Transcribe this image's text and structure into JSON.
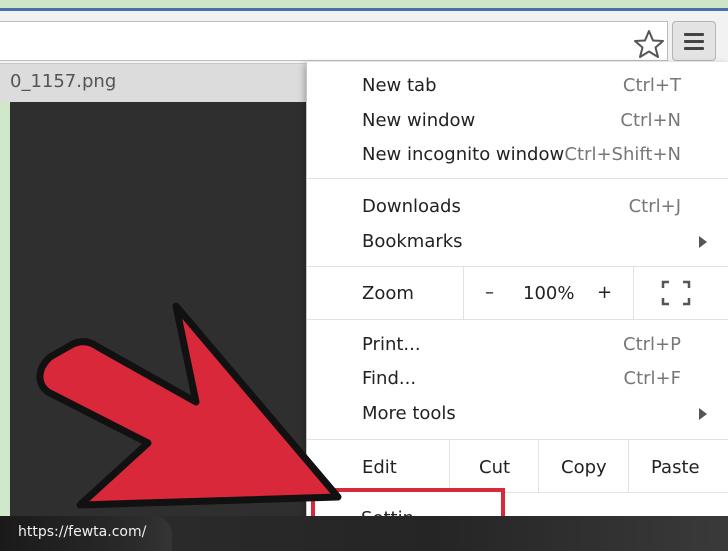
{
  "tab": {
    "title": "0_1157.png"
  },
  "menu": {
    "items": [
      {
        "label": "New tab",
        "shortcut": "Ctrl+T"
      },
      {
        "label": "New window",
        "shortcut": "Ctrl+N"
      },
      {
        "label": "New incognito window",
        "shortcut": "Ctrl+Shift+N"
      },
      {
        "label": "Downloads",
        "shortcut": "Ctrl+J"
      },
      {
        "label": "Bookmarks",
        "shortcut": ""
      },
      {
        "label": "Print...",
        "shortcut": "Ctrl+P"
      },
      {
        "label": "Find...",
        "shortcut": "Ctrl+F"
      },
      {
        "label": "More tools",
        "shortcut": ""
      }
    ],
    "zoom": {
      "label": "Zoom",
      "minus": "–",
      "value": "100%",
      "plus": "+"
    },
    "edit": {
      "label": "Edit",
      "cut": "Cut",
      "copy": "Copy",
      "paste": "Paste"
    },
    "settings": {
      "label": "Settin"
    }
  },
  "status": {
    "url": "https://fewta.com/"
  },
  "colors": {
    "arrow": "#d8283a",
    "highlight": "#d8283a",
    "background": "#c9e3c3"
  }
}
